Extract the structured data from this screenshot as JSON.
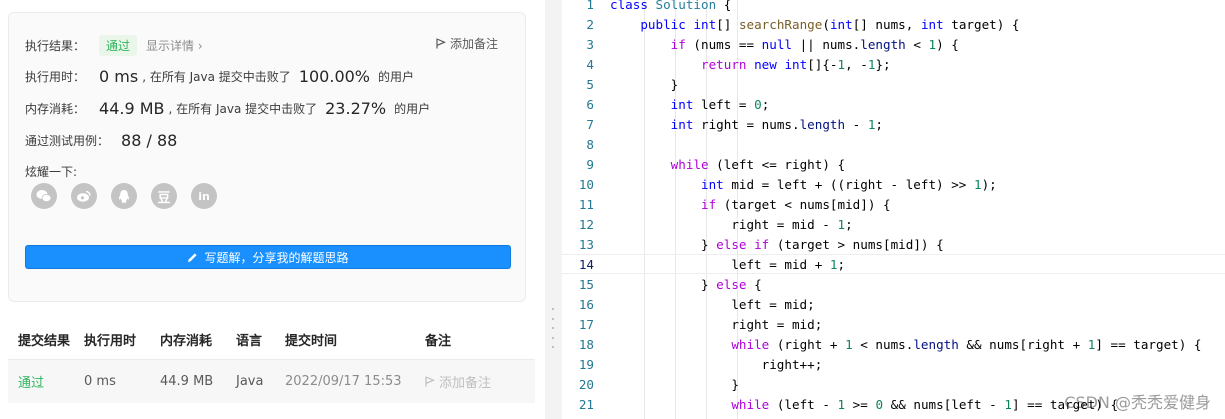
{
  "result_card": {
    "label_result": "执行结果：",
    "status": "通过",
    "details_link": "显示详情 ›",
    "add_note": "添加备注",
    "runtime_label": "执行用时：",
    "runtime_value": "0 ms",
    "runtime_beat_text": ", 在所有 Java 提交中击败了",
    "runtime_pct": "100.00%",
    "users_text": "的用户",
    "memory_label": "内存消耗：",
    "memory_value": "44.9 MB",
    "memory_beat_text": ", 在所有 Java 提交中击败了",
    "memory_pct": "23.27%",
    "tests_label": "通过测试用例：",
    "tests_value": "88 / 88",
    "share_label": "炫耀一下:",
    "share_icons": [
      "wechat-icon",
      "weibo-icon",
      "qq-icon",
      "douban-icon",
      "linkedin-icon"
    ],
    "write_button": "写题解，分享我的解题思路"
  },
  "submissions": {
    "headers": [
      "提交结果",
      "执行用时",
      "内存消耗",
      "语言",
      "提交时间",
      "备注"
    ],
    "rows": [
      {
        "result": "通过",
        "runtime": "0 ms",
        "memory": "44.9 MB",
        "language": "Java",
        "time": "2022/09/17 15:53",
        "note": "添加备注"
      }
    ]
  },
  "editor": {
    "current_line": 14,
    "lines": [
      "class Solution {",
      "    public int[] searchRange(int[] nums, int target) {",
      "        if (nums == null || nums.length < 1) {",
      "            return new int[]{-1, -1};",
      "        }",
      "        int left = 0;",
      "        int right = nums.length - 1;",
      "",
      "        while (left <= right) {",
      "            int mid = left + ((right - left) >> 1);",
      "            if (target < nums[mid]) {",
      "                right = mid - 1;",
      "            } else if (target > nums[mid]) {",
      "                left = mid + 1;",
      "            } else {",
      "                left = mid;",
      "                right = mid;",
      "                while (right + 1 < nums.length && nums[right + 1] == target) {",
      "                    right++;",
      "                }",
      "                while (left - 1 >= 0 && nums[left - 1] == target) {"
    ]
  },
  "watermark": "CSDN @秃秃爱健身",
  "colors": {
    "accent_blue": "#1a90ff",
    "pass_green": "#2db55d"
  }
}
